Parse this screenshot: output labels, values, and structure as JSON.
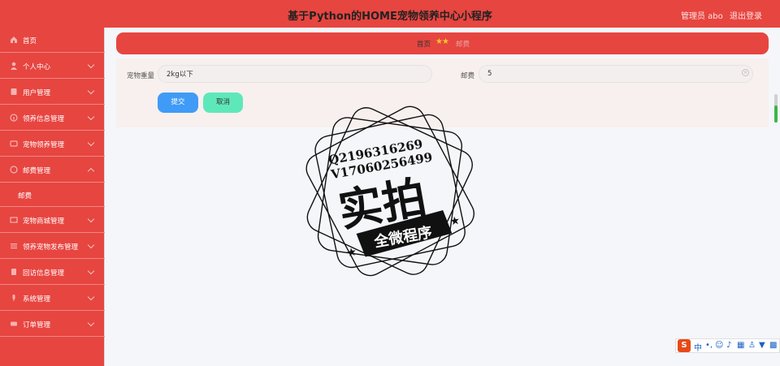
{
  "header": {
    "title": "基于Python的HOME宠物领养中心小程序",
    "admin": "管理员 abo",
    "logout": "退出登录"
  },
  "sidebar": {
    "items": [
      {
        "label": "首页",
        "icon": "home-icon"
      },
      {
        "label": "个人中心",
        "icon": "user-icon"
      },
      {
        "label": "用户管理",
        "icon": "users-icon"
      },
      {
        "label": "领养信息管理",
        "icon": "info-icon"
      },
      {
        "label": "宠物领养管理",
        "icon": "pet-icon"
      },
      {
        "label": "邮费管理",
        "icon": "shipping-icon",
        "expanded": true
      },
      {
        "label": "宠物商城管理",
        "icon": "shop-icon"
      },
      {
        "label": "领养宠物发布管理",
        "icon": "publish-icon"
      },
      {
        "label": "回访信息管理",
        "icon": "visit-icon"
      },
      {
        "label": "系统管理",
        "icon": "system-icon"
      },
      {
        "label": "订单管理",
        "icon": "order-icon"
      }
    ],
    "submenu": {
      "label": "邮费"
    }
  },
  "breadcrumb": {
    "home": "首页",
    "current": "邮费"
  },
  "form": {
    "weight_label": "宠物重量",
    "weight_value": "2kg以下",
    "fee_label": "邮费",
    "fee_value": "5",
    "submit": "提交",
    "cancel": "取消"
  },
  "watermark": {
    "line1": "Q2196316269",
    "line2": "V17060256499",
    "big": "实拍",
    "banner": "全微程序"
  },
  "ime": {
    "logo": "S",
    "mode": "中"
  },
  "colors": {
    "brand": "#e74540",
    "submit": "#3f9bf6",
    "cancel": "#5ee8b9"
  }
}
